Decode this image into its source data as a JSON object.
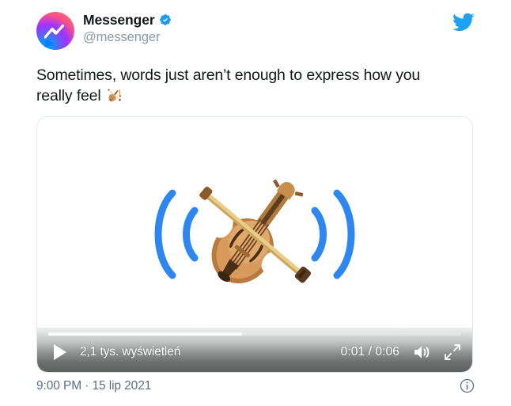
{
  "platform": {
    "logo_icon": "twitter-bird-icon",
    "brand_color": "#1da1f2"
  },
  "author": {
    "display_name": "Messenger",
    "handle": "@messenger",
    "verified": true,
    "verified_icon": "verified-badge-icon",
    "avatar_icon": "messenger-logo-avatar",
    "avatar_gradient_start": "#0099ff",
    "avatar_gradient_mid": "#a033ff",
    "avatar_gradient_end": "#ff7061"
  },
  "tweet": {
    "text_line1": "Sometimes, words just aren’t enough to express how you",
    "text_line2": "really feel",
    "emoji": "🎻🎻",
    "emoji_name": "violin-emoji"
  },
  "media": {
    "type": "video",
    "art_icon": "violin-with-sound-waves",
    "sound_wave_color": "#2e86f0",
    "controls": {
      "play_label": "play-button",
      "views": "2,1 tys. wyświetleń",
      "current_time": "0:01",
      "duration": "0:06",
      "timecode": "0:01 / 0:06",
      "progress_percent": 47,
      "volume_icon": "speaker-on-icon",
      "fullscreen_icon": "expand-icon"
    }
  },
  "footer": {
    "timestamp": "9:00 PM · 15 lip 2021",
    "info_icon": "info-circle-icon"
  }
}
